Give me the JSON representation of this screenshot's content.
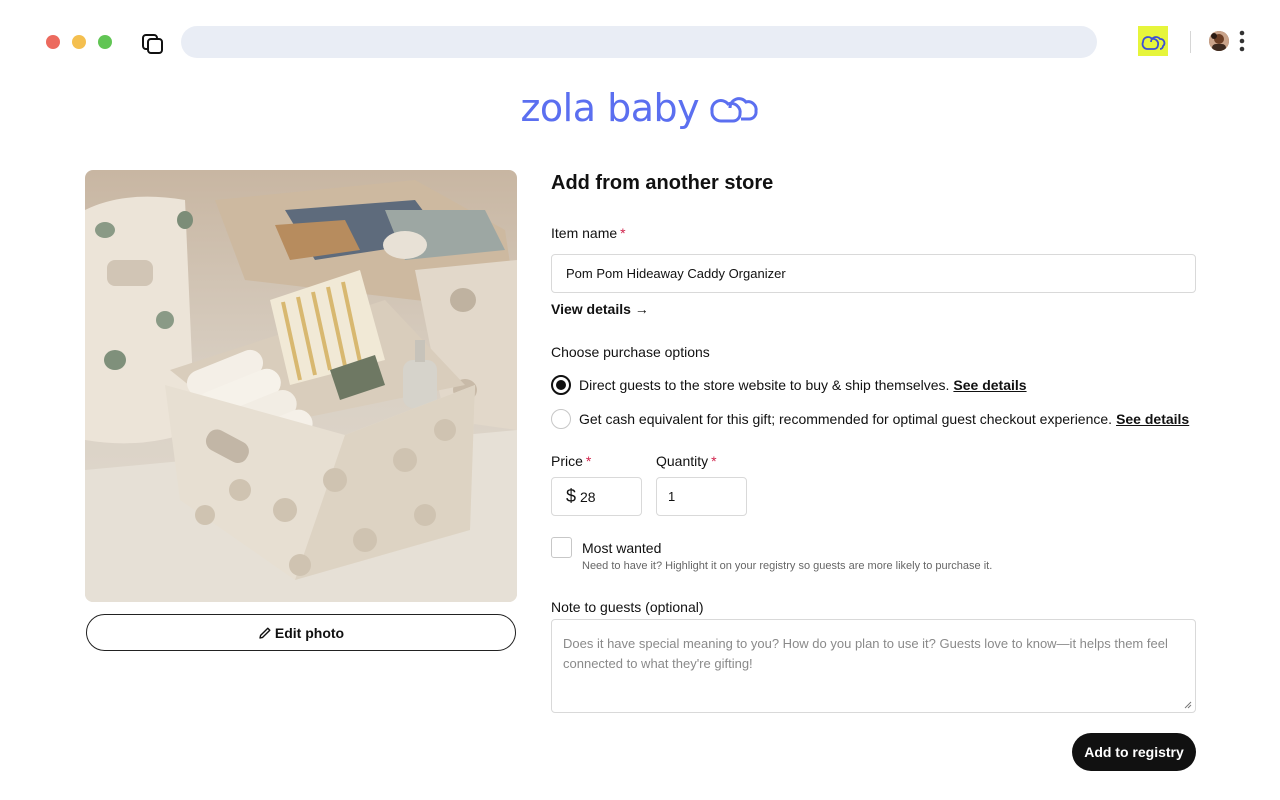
{
  "browser": {
    "window_controls": [
      "close",
      "minimize",
      "maximize"
    ],
    "url": "",
    "icons": [
      "tabs-icon",
      "zola-extension-icon",
      "profile-avatar",
      "kebab-menu-icon"
    ]
  },
  "brand": {
    "logo_text": "zola baby",
    "accent": "#5b6ff0",
    "extension_bg": "#e6f53b"
  },
  "product": {
    "photo_alt": "Fabric caddy organizer with diapers and baby supplies",
    "edit_photo_label": "Edit photo"
  },
  "form": {
    "title": "Add from another store",
    "item_name": {
      "label": "Item name",
      "required_mark": "*",
      "value": "Pom Pom Hideaway Caddy Organizer"
    },
    "view_details": "View details →",
    "purchase_options": {
      "label": "Choose purchase options",
      "options": [
        {
          "text": "Direct guests to the store website to buy & ship themselves.",
          "link": "See details",
          "selected": true
        },
        {
          "text": "Get cash equivalent for this gift; recommended for optimal guest checkout experience.",
          "link": "See details",
          "selected": false
        }
      ]
    },
    "price": {
      "label": "Price",
      "required_mark": "*",
      "currency": "$",
      "value": "28"
    },
    "quantity": {
      "label": "Quantity",
      "required_mark": "*",
      "value": "1"
    },
    "most_wanted": {
      "label": "Most wanted",
      "checked": false,
      "hint": "Need to have it? Highlight it on your registry so guests are more likely to purchase it."
    },
    "note": {
      "label": "Note to guests (optional)",
      "placeholder": "Does it have special meaning to you? How do you plan to use it? Guests love to know—it helps them feel connected to what they're gifting!"
    },
    "submit_label": "Add to registry"
  }
}
